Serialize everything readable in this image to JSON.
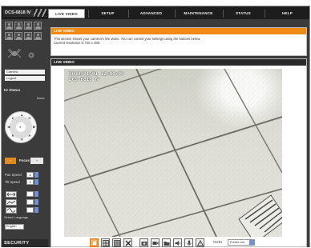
{
  "header": {
    "model": "DCS-6818 Ⅳ",
    "tabs": [
      {
        "label": "LIVE VIDEO",
        "active": true
      },
      {
        "label": "SETUP",
        "active": false
      },
      {
        "label": "ADVANCED",
        "active": false
      },
      {
        "label": "MAINTENANCE",
        "active": false
      },
      {
        "label": "STATUS",
        "active": false
      },
      {
        "label": "HELP",
        "active": false
      }
    ]
  },
  "sidebar": {
    "links": [
      "Camera",
      "Logout"
    ],
    "io_status_label": "IO Status",
    "mode_label": "None",
    "zoom": {
      "label": "Presets",
      "minus": "−",
      "plus": "+",
      "focus": "Focus"
    },
    "pan_speed": {
      "label": "Pan Speed",
      "value": "3"
    },
    "tilt_speed": {
      "label": "Tilt Speed",
      "value": "3"
    },
    "language": {
      "label": "Select Language",
      "value": "English"
    },
    "brand": "SECURITY"
  },
  "info": {
    "title": "LIVE VIDEO",
    "text1": "This section shows your camera's live video. You can control your settings using the buttons below.",
    "text2": "Current resolution is 720 x 480."
  },
  "video": {
    "title": "LIVE VIDEO",
    "osd_line1": "2013/01/01 12:00:00",
    "osd_line2": "DCS-6818 Ⅳ"
  },
  "toolbar": {
    "goto_label": "GoTo",
    "preset_value": "Preset List"
  },
  "colors": {
    "accent_orange": "#f08a12",
    "dark_bg": "#3b3b3b",
    "top_bar": "#1d1d1d"
  }
}
